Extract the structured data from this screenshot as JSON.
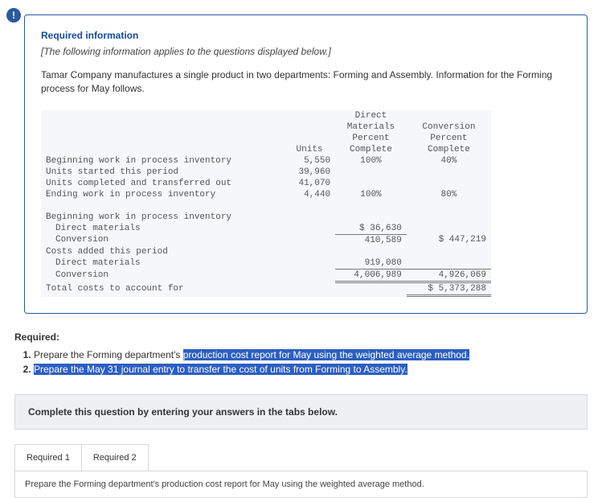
{
  "alert_icon": "!",
  "info": {
    "heading": "Required information",
    "context": "[The following information applies to the questions displayed below.]",
    "intro": "Tamar Company manufactures a single product in two departments: Forming and Assembly. Information for the Forming process for May follows."
  },
  "table": {
    "headers": {
      "c1_line1": "",
      "c1_line2": "",
      "c1_line3": "Units",
      "c2_line1": "Direct",
      "c2_line2": "Materials",
      "c2_line3": "Percent",
      "c2_line4": "Complete",
      "c3_line1": "",
      "c3_line2": "Conversion",
      "c3_line3": "Percent",
      "c3_line4": "Complete"
    },
    "rows1": [
      {
        "label": "Beginning work in process inventory",
        "units": "5,550",
        "dm": "100%",
        "conv": "40%"
      },
      {
        "label": "Units started this period",
        "units": "39,960",
        "dm": "",
        "conv": ""
      },
      {
        "label": "Units completed and transferred out",
        "units": "41,070",
        "dm": "",
        "conv": ""
      },
      {
        "label": "Ending work in process inventory",
        "units": "4,440",
        "dm": "100%",
        "conv": "80%"
      }
    ],
    "section2_label": "Beginning work in process inventory",
    "rows2": [
      {
        "label": "  Direct materials",
        "c2": "$ 36,630",
        "c3": ""
      },
      {
        "label": "  Conversion",
        "c2": "410,589",
        "c3": "$ 447,219"
      }
    ],
    "section3_label": "Costs added this period",
    "rows3": [
      {
        "label": "  Direct materials",
        "c2": "919,080",
        "c3": ""
      },
      {
        "label": "  Conversion",
        "c2": "4,006,989",
        "c3": "4,926,069"
      }
    ],
    "total_row": {
      "label": "Total costs to account for",
      "c3": "$ 5,373,288"
    }
  },
  "required": {
    "heading": "Required:",
    "item1_a": "Prepare the Forming department's ",
    "item1_b": "production cost report for May using the weighted average method.",
    "item2": "Prepare the May 31 journal entry to transfer the cost of units from Forming to Assembly."
  },
  "instruction": "Complete this question by entering your answers in the tabs below.",
  "tabs": {
    "t1": "Required 1",
    "t2": "Required 2",
    "content1": "Prepare the Forming department's production cost report for May using the weighted average method."
  }
}
